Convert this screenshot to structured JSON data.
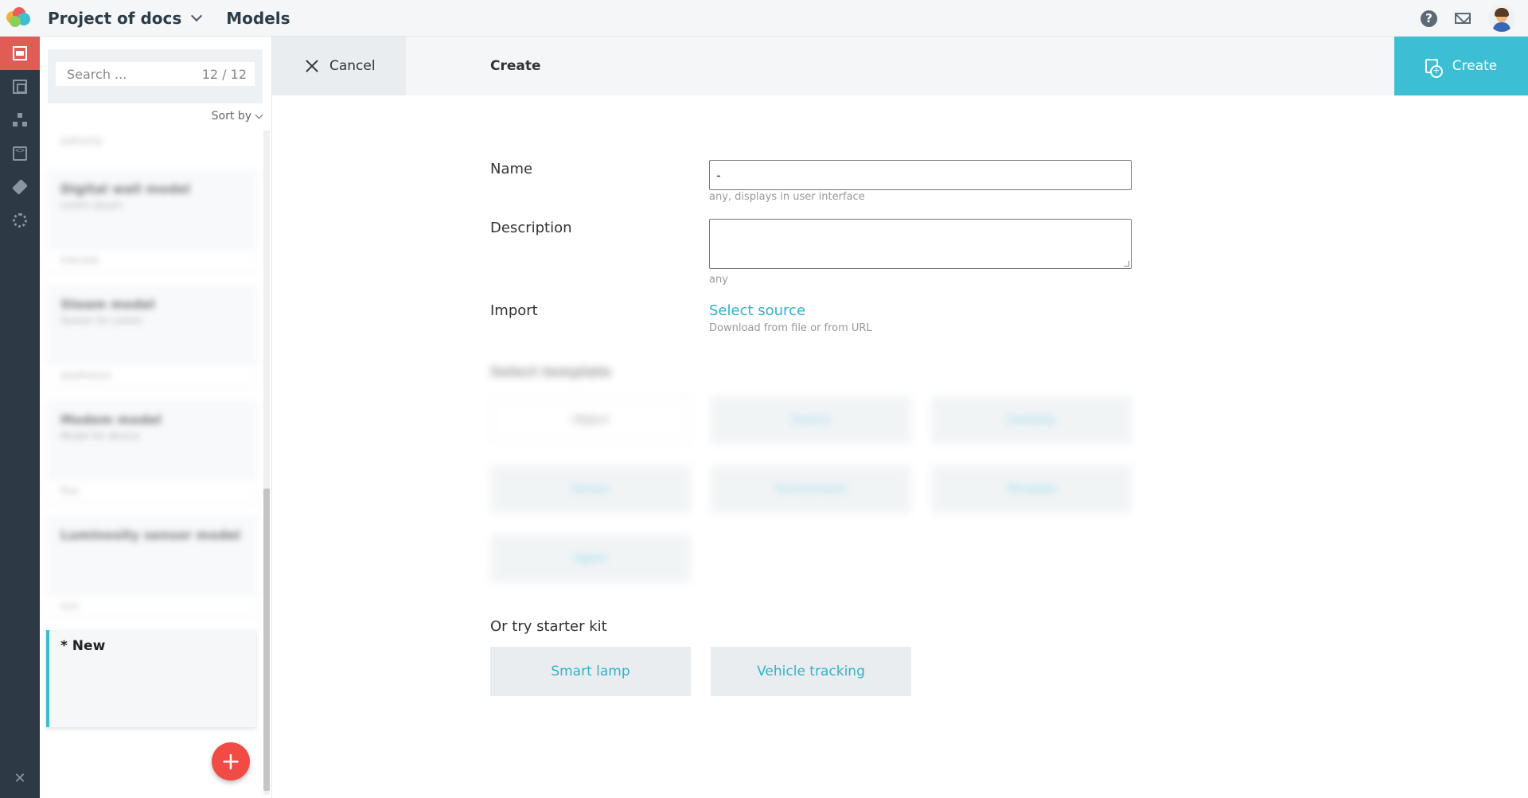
{
  "header": {
    "project": "Project of docs",
    "section": "Models"
  },
  "search": {
    "placeholder": "Search ...",
    "count": "12 / 12",
    "sort_label": "Sort by"
  },
  "list": {
    "cards": [
      {
        "title": "",
        "subtitle": "",
        "footer": "pathonly"
      },
      {
        "title": "Digital wall model",
        "subtitle": "Lorem ipsum",
        "footer": "mbvedo"
      },
      {
        "title": "Steam model",
        "subtitle": "Sensor for Lorem",
        "footer": "weatheron"
      },
      {
        "title": "Modem model",
        "subtitle": "Model for device",
        "footer": "fine"
      },
      {
        "title": "Luminosity sensor model",
        "subtitle": "",
        "footer": "lum"
      }
    ],
    "new_card": "* New"
  },
  "actionbar": {
    "cancel": "Cancel",
    "title": "Create",
    "create": "Create"
  },
  "form": {
    "name_label": "Name",
    "name_value": "-",
    "name_hint": "any, displays in user interface",
    "description_label": "Description",
    "description_hint": "any",
    "import_label": "Import",
    "import_link": "Select source",
    "import_hint": "Download from file or from URL",
    "templates_title": "Select template",
    "templates": [
      "Object",
      "Device",
      "Gateway",
      "Sensor",
      "Environment",
      "Template",
      "Agent"
    ],
    "starter_title": "Or try starter kit",
    "starter_kits": [
      "Smart lamp",
      "Vehicle tracking"
    ]
  },
  "colors": {
    "accent": "#3cbfd4",
    "rail": "#2d3a46",
    "rail_active": "#e05d55",
    "fab": "#f04b45"
  }
}
